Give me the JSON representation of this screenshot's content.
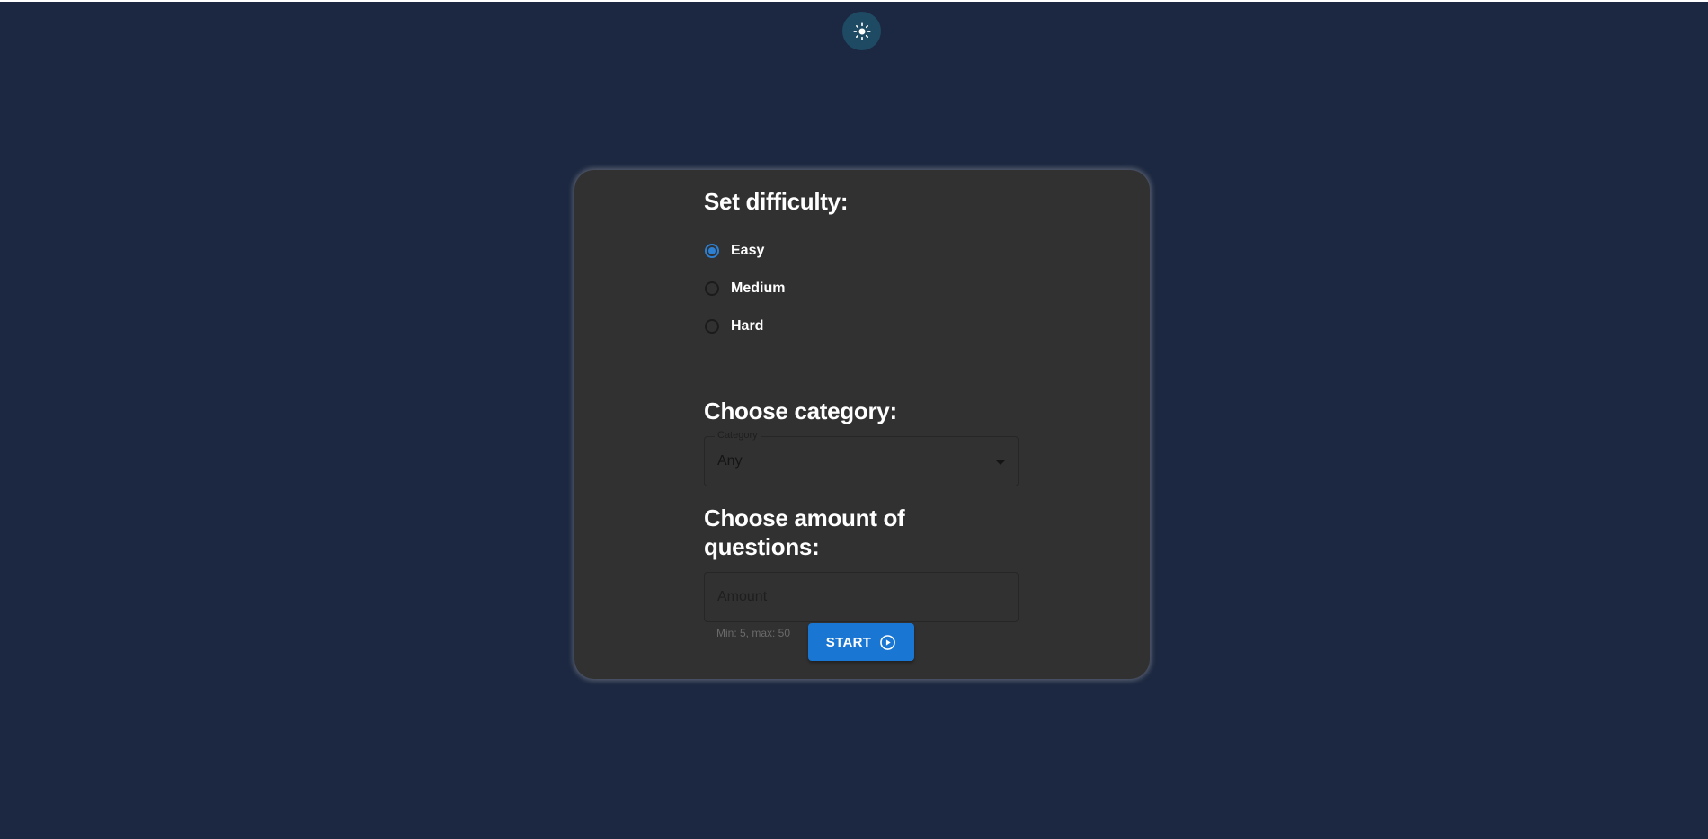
{
  "theme_toggle": {
    "icon": "sun-icon"
  },
  "difficulty": {
    "title": "Set difficulty:",
    "options": [
      {
        "label": "Easy",
        "checked": true
      },
      {
        "label": "Medium",
        "checked": false
      },
      {
        "label": "Hard",
        "checked": false
      }
    ]
  },
  "category": {
    "title": "Choose category:",
    "legend": "Category",
    "selected": "Any"
  },
  "amount": {
    "title": "Choose amount of questions:",
    "placeholder": "Amount",
    "helper": "Min: 5, max: 50"
  },
  "start_button": {
    "label": "START",
    "icon": "play-circle-icon"
  },
  "colors": {
    "background": "#1c2841",
    "card": "#313131",
    "accent": "#1976d2",
    "toggle": "#1f4a63"
  }
}
